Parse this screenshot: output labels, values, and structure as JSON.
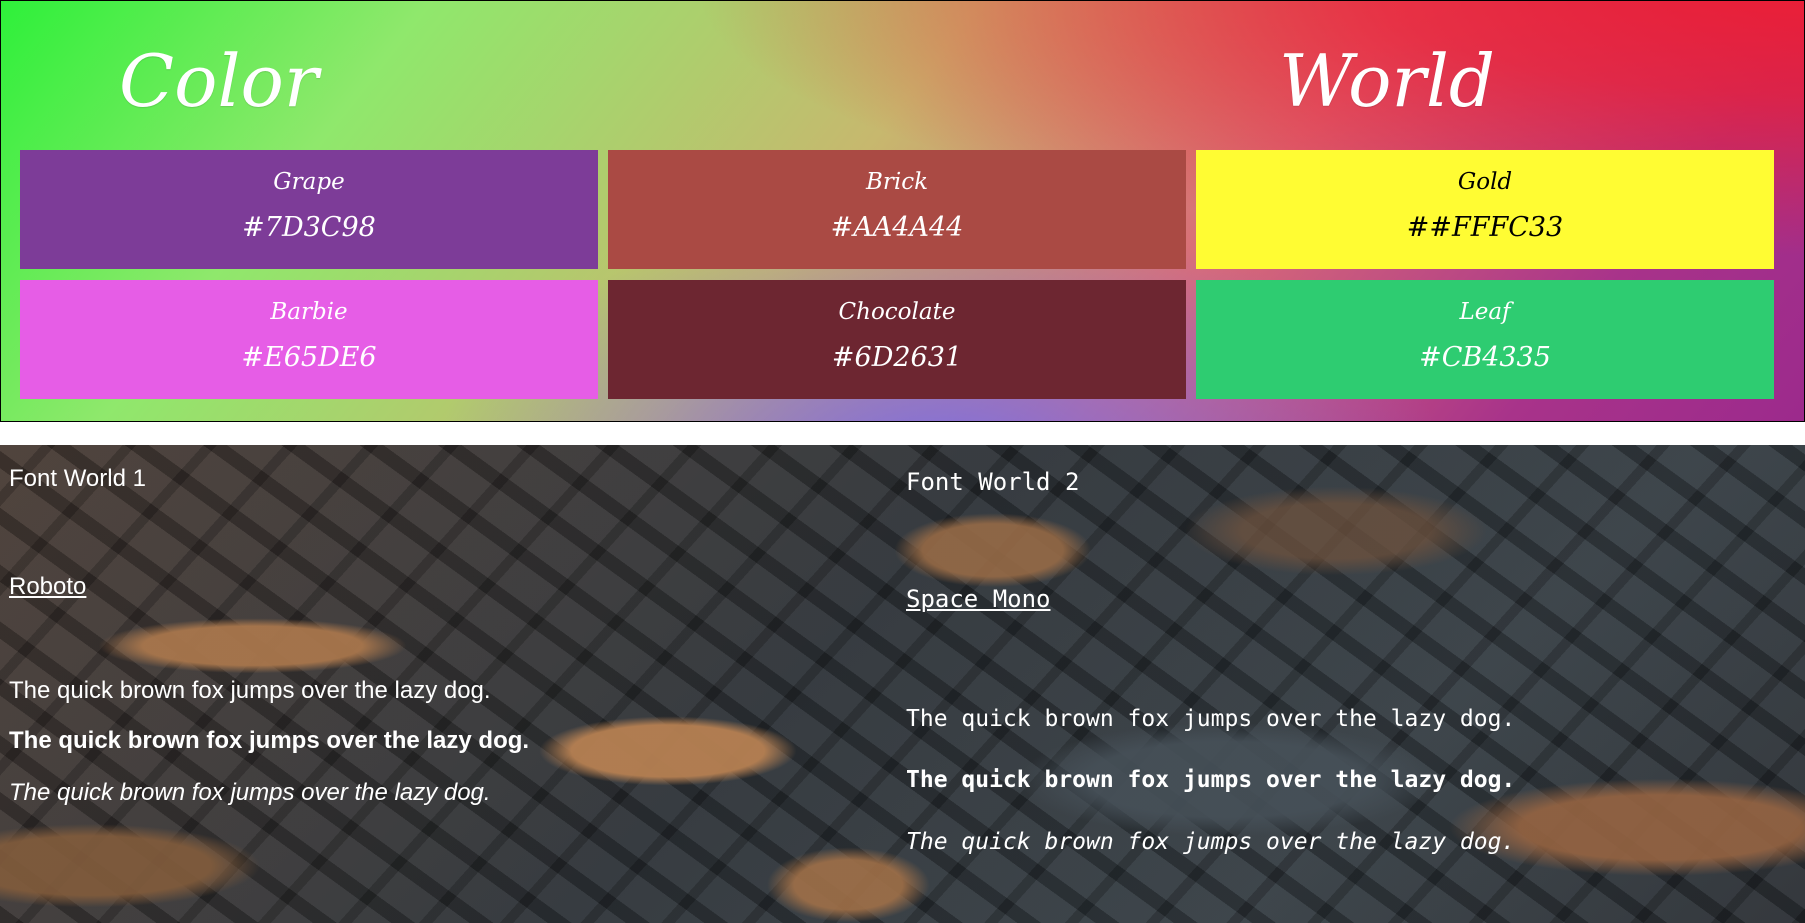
{
  "color_world": {
    "title_left": "Color",
    "title_right": "World",
    "swatches": [
      {
        "name": "Grape",
        "hex": "#7D3C98",
        "bg": "#7D3C98",
        "text_color": "#ffffff"
      },
      {
        "name": "Brick",
        "hex": "#AA4A44",
        "bg": "#AA4A44",
        "text_color": "#ffffff"
      },
      {
        "name": "Gold",
        "hex": "##FFFC33",
        "bg": "#FFFC33",
        "text_color": "#000000"
      },
      {
        "name": "Barbie",
        "hex": "#E65DE6",
        "bg": "#E65DE6",
        "text_color": "#ffffff"
      },
      {
        "name": "Chocolate",
        "hex": "#6D2631",
        "bg": "#6D2631",
        "text_color": "#ffffff"
      },
      {
        "name": "Leaf",
        "hex": "#CB4335",
        "bg": "#2ECC71",
        "text_color": "#ffffff"
      }
    ]
  },
  "font_world": {
    "columns": [
      {
        "heading": "Font World 1",
        "font_link": "Roboto",
        "sample_regular": "The quick brown fox jumps over the lazy dog.",
        "sample_bold": "The quick brown fox jumps over the lazy dog.",
        "sample_italic": "The quick brown fox jumps over the lazy dog."
      },
      {
        "heading": "Font World 2",
        "font_link": "Space Mono",
        "sample_regular": "The quick brown fox jumps over the lazy dog.",
        "sample_bold": "The quick brown fox jumps over the lazy dog.",
        "sample_italic": "The quick brown fox jumps over the lazy dog."
      }
    ]
  }
}
